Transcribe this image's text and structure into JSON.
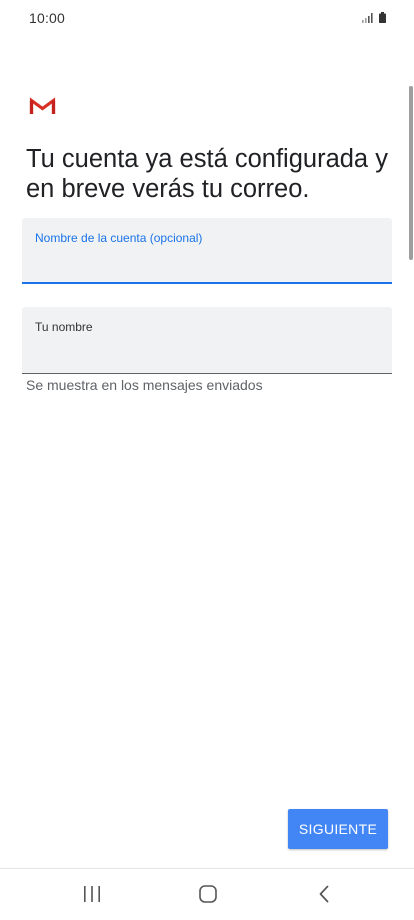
{
  "status_bar": {
    "time": "10:00",
    "icons": [
      "signal-icon",
      "battery-icon"
    ]
  },
  "app": {
    "logo_icon": "gmail-logo",
    "brand_colors": {
      "gmail_red": "#d93025",
      "accent_blue": "#1a73e8",
      "button_blue": "#4285f4"
    }
  },
  "title": "Tu cuenta ya está configurada y en breve verás tu correo.",
  "account_name_field": {
    "label": "Nombre de la cuenta (opcional)",
    "value": ""
  },
  "your_name_field": {
    "label": "Tu nombre",
    "value": "",
    "helper": "Se muestra en los mensajes enviados"
  },
  "next_button": {
    "label": "SIGUIENTE"
  },
  "nav_bar": {
    "buttons": [
      "recents-icon",
      "home-icon",
      "back-icon"
    ]
  }
}
